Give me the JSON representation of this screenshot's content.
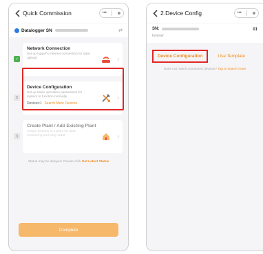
{
  "left": {
    "title": "Quick Commission",
    "capsule": {
      "more": "•••",
      "close": "⊗"
    },
    "logger_label": "Datalogger SN",
    "steps": [
      {
        "mark": "✓",
        "title": "Network Connection",
        "desc": "Set up logger's internet connection for data upload",
        "icon": "router-icon"
      },
      {
        "mark": "2",
        "title": "Device Configuration",
        "desc": "Set up basic operation parameters for system to function normally",
        "devices_label": "Devices:1",
        "link": "Search More Devices",
        "icon": "tools-icon"
      },
      {
        "mark": "3",
        "title": "Create Plant / Add Existing Plant",
        "desc": "Assign devices to a plant for data monitoring and easy O&M",
        "icon": "plant-icon"
      }
    ],
    "status_text": "Status may be delayed. Please click",
    "status_link": "Get Latest Status",
    "complete_label": "Complete"
  },
  "right": {
    "title": "2.Device Config",
    "capsule": {
      "more": "•••",
      "close": "⊗"
    },
    "sn_label": "SN:",
    "sn_index": "01",
    "device_type": "Inverter",
    "tabs": [
      "Device Configuration",
      "Use Template"
    ],
    "hint_text": "Does not match connected devices?",
    "hint_link": "Tap to search more"
  },
  "colors": {
    "accent": "#f28b1e",
    "highlight": "#e02626",
    "done": "#4caf50",
    "logger": "#2d7be5"
  }
}
